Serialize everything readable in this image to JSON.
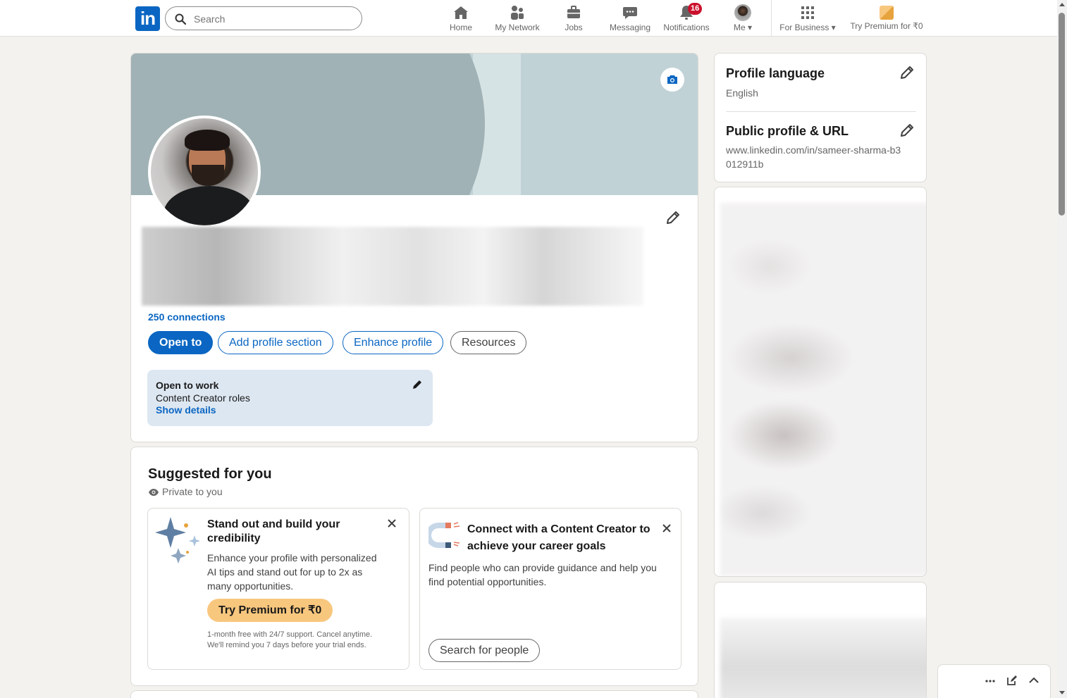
{
  "nav": {
    "logo_text": "in",
    "search_placeholder": "Search",
    "items": [
      {
        "label": "Home",
        "icon": "home-icon"
      },
      {
        "label": "My Network",
        "icon": "network-icon"
      },
      {
        "label": "Jobs",
        "icon": "briefcase-icon"
      },
      {
        "label": "Messaging",
        "icon": "chat-icon"
      },
      {
        "label": "Notifications",
        "icon": "bell-icon",
        "badge": "16"
      },
      {
        "label": "Me",
        "icon": "avatar"
      },
      {
        "label": "For Business",
        "icon": "grid-icon"
      },
      {
        "label": "Try Premium for ₹0",
        "icon": "premium-icon"
      }
    ]
  },
  "profile": {
    "connections": "250 connections",
    "buttons": {
      "open_to": "Open to",
      "add_section": "Add profile section",
      "enhance": "Enhance profile",
      "resources": "Resources"
    },
    "open_to_work": {
      "title": "Open to work",
      "roles": "Content Creator roles",
      "link": "Show details"
    }
  },
  "sidebar": {
    "language": {
      "title": "Profile language",
      "value": "English"
    },
    "public_profile": {
      "title": "Public profile & URL",
      "url": "www.linkedin.com/in/sameer-sharma-b3012911b"
    }
  },
  "suggested": {
    "title": "Suggested for you",
    "privacy": "Private to you",
    "cards": [
      {
        "heading": "Stand out and build your credibility",
        "body": "Enhance your profile with personalized AI tips and stand out for up to 2x as many opportunities.",
        "button": "Try Premium for ₹0",
        "fineprint": "1-month free with 24/7 support. Cancel anytime. We'll remind you 7 days before your trial ends."
      },
      {
        "heading": "Connect with a Content Creator to achieve your career goals",
        "body": "Find people who can provide guidance and help you find potential opportunities.",
        "button": "Search for people"
      }
    ]
  },
  "colors": {
    "brand": "#0a66c2",
    "premium": "#f8c77e",
    "badge": "#cb112d",
    "page_bg": "#f4f2ee"
  }
}
